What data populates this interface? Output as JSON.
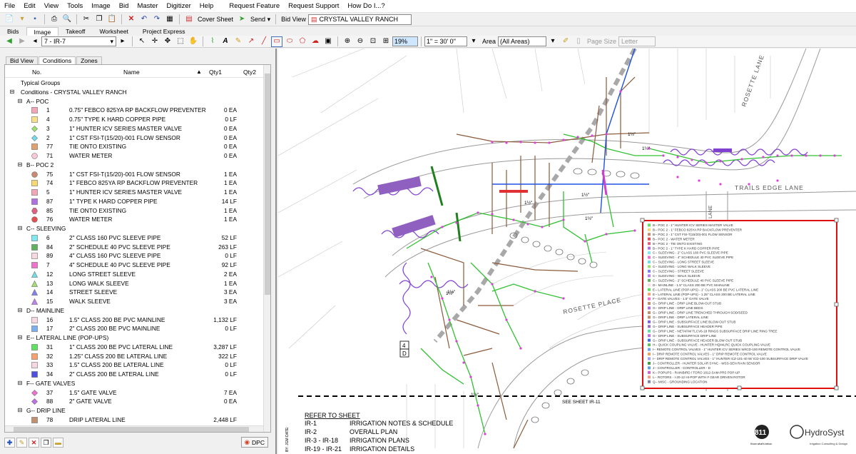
{
  "menu": [
    "File",
    "Edit",
    "View",
    "Tools",
    "Image",
    "Bid",
    "Master",
    "Digitizer",
    "Help",
    "Request Feature",
    "Request Support",
    "How Do I...?"
  ],
  "toolbar": {
    "cover_sheet": "Cover Sheet",
    "send": "Send",
    "bid_view_label": "Bid View",
    "bid_name": "CRYSTAL VALLEY RANCH"
  },
  "tabs": [
    "Bids",
    "Image",
    "Takeoff",
    "Worksheet",
    "Project Express"
  ],
  "active_tab": "Image",
  "image_toolbar": {
    "page": "7 - IR-7",
    "zoom": "19%",
    "scale": "1\" = 30' 0\"",
    "area_label": "Area",
    "area_value": "(All Areas)",
    "page_size_label": "Page Size",
    "page_size_value": "Letter"
  },
  "panel": {
    "tabs": [
      "Bid View",
      "Conditions",
      "Zones"
    ],
    "active": "Conditions",
    "columns": {
      "no": "No.",
      "name": "Name",
      "qty1": "Qty1",
      "qty2": "Qty2"
    },
    "typical_groups": "Typical Groups",
    "root": "Conditions - CRYSTAL VALLEY RANCH",
    "groups": [
      {
        "name": "A-- POC",
        "items": [
          {
            "no": "1",
            "name": "0.75\" FEBCO 825YA RP BACKFLOW PREVENTER",
            "qty1": "0 EA",
            "color": "#f4a6b6",
            "shape": "square"
          },
          {
            "no": "4",
            "name": "0.75\" TYPE K HARD COPPER PIPE",
            "qty1": "0 LF",
            "color": "#f8e08a",
            "shape": "square"
          },
          {
            "no": "3",
            "name": "1\"  HUNTER ICV SERIES MASTER VALVE",
            "qty1": "0 EA",
            "color": "#9be36a",
            "shape": "diamond"
          },
          {
            "no": "2",
            "name": "1\" CST FSI-T(15/20)-001 FLOW SENSOR",
            "qty1": "0 EA",
            "color": "#6fdcf0",
            "shape": "diamond"
          },
          {
            "no": "77",
            "name": "TIE ONTO EXISTING",
            "qty1": "0 EA",
            "color": "#e0a070",
            "shape": "square"
          },
          {
            "no": "71",
            "name": "WATER METER",
            "qty1": "0 EA",
            "color": "#f8c8d8",
            "shape": "circle"
          }
        ]
      },
      {
        "name": "B-- POC 2",
        "items": [
          {
            "no": "75",
            "name": "1\" CST FSI-T(15/20)-001 FLOW SENSOR",
            "qty1": "1 EA",
            "color": "#c88a70",
            "shape": "circle"
          },
          {
            "no": "74",
            "name": "1\" FEBCO 825YA RP BACKFLOW PREVENTER",
            "qty1": "1 EA",
            "color": "#f8d870",
            "shape": "square"
          },
          {
            "no": "5",
            "name": "1\" HUNTER ICV SERIES MASTER VALVE",
            "qty1": "1 EA",
            "color": "#f4a6b6",
            "shape": "square"
          },
          {
            "no": "87",
            "name": "1\" TYPE K HARD COPPER PIPE",
            "qty1": "14 LF",
            "color": "#b070e0",
            "shape": "square"
          },
          {
            "no": "85",
            "name": "TIE ONTO EXISTING",
            "qty1": "1 EA",
            "color": "#e06080",
            "shape": "hex"
          },
          {
            "no": "76",
            "name": "WATER METER",
            "qty1": "1 EA",
            "color": "#e05050",
            "shape": "circle"
          }
        ]
      },
      {
        "name": "C-- SLEEVING",
        "items": [
          {
            "no": "6",
            "name": "2\" CLASS 160 PVC SLEEVE PIPE",
            "qty1": "52 LF",
            "color": "#7fe8f0",
            "shape": "square"
          },
          {
            "no": "84",
            "name": "2\" SCHEDULE 40 PVC SLEEVE PIPE",
            "qty1": "263 LF",
            "color": "#60b060",
            "shape": "square"
          },
          {
            "no": "89",
            "name": "4\" CLASS 160 PVC SLEEVE PIPE",
            "qty1": "0 LF",
            "color": "#f8d8e0",
            "shape": "square"
          },
          {
            "no": "7",
            "name": "4\" SCHEDULE 40 PVC SLEEVE PIPE",
            "qty1": "92 LF",
            "color": "#f070d0",
            "shape": "square"
          },
          {
            "no": "12",
            "name": "LONG STREET SLEEVE",
            "qty1": "2 EA",
            "color": "#70e0e8",
            "shape": "triangle"
          },
          {
            "no": "13",
            "name": "LONG WALK SLEEVE",
            "qty1": "1 EA",
            "color": "#a0e070",
            "shape": "triangle"
          },
          {
            "no": "14",
            "name": "STREET SLEEVE",
            "qty1": "3 EA",
            "color": "#8080f0",
            "shape": "triangle"
          },
          {
            "no": "15",
            "name": "WALK SLEEVE",
            "qty1": "3 EA",
            "color": "#c080f0",
            "shape": "triangle"
          }
        ]
      },
      {
        "name": "D-- MAINLINE",
        "items": [
          {
            "no": "16",
            "name": "1.5\" CLASS 200 BE PVC MAINLINE",
            "qty1": "1,132 LF",
            "color": "#f8d8e0",
            "shape": "square"
          },
          {
            "no": "17",
            "name": "2\" CLASS 200 BE PVC MAINLINE",
            "qty1": "0 LF",
            "color": "#7ab0f0",
            "shape": "square"
          }
        ]
      },
      {
        "name": "E-- LATERAL LINE (POP-UPS)",
        "items": [
          {
            "no": "31",
            "name": "1\" CLASS 200 BE PVC LATERAL LINE",
            "qty1": "3,287 LF",
            "color": "#60e060",
            "shape": "square"
          },
          {
            "no": "32",
            "name": "1.25\" CLASS 200 BE LATERAL LINE",
            "qty1": "322 LF",
            "color": "#f8a070",
            "shape": "square"
          },
          {
            "no": "33",
            "name": "1.5\" CLASS 200 BE LATERAL LINE",
            "qty1": "0 LF",
            "color": "#f8d8e0",
            "shape": "square"
          },
          {
            "no": "34",
            "name": "2\" CLASS 200 BE LATERAL LINE",
            "qty1": "0 LF",
            "color": "#5050e0",
            "shape": "square"
          }
        ]
      },
      {
        "name": "F-- GATE VALVES",
        "items": [
          {
            "no": "37",
            "name": "1.5\" GATE VALVE",
            "qty1": "7 EA",
            "color": "#f070d0",
            "shape": "diamond"
          },
          {
            "no": "88",
            "name": "2\" GATE VALVE",
            "qty1": "0 EA",
            "color": "#c070e0",
            "shape": "diamond"
          }
        ]
      },
      {
        "name": "G-- DRIP LINE",
        "items": [
          {
            "no": "78",
            "name": "DRIP LATERAL LINE",
            "qty1": "2,448 LF",
            "color": "#c09070",
            "shape": "square"
          }
        ]
      }
    ],
    "buttons": {
      "dpc": "DPC"
    }
  },
  "drawing": {
    "streets": [
      "ROSETTE LANE",
      "TRAILS EDGE LANE",
      "ROSETTE PLACE",
      "LANE"
    ],
    "see_sheet": "SEE SHEET IR-11",
    "sheet_tag": [
      "4",
      "D"
    ],
    "pipe_labels": [
      "1½\"",
      "1½\"",
      "1½\"",
      "1½\"",
      "1½\"",
      "1½\"",
      "1½\"",
      "1½\""
    ],
    "refer_title": "REFER TO SHEET",
    "refer_rows": [
      {
        "sheet": "IR-1",
        "desc": "IRRIGATION NOTES & SCHEDULE"
      },
      {
        "sheet": "IR-2",
        "desc": "OVERALL PLAN"
      },
      {
        "sheet": "IR-3 - IR-18",
        "desc": "IRRIGATION PLANS"
      },
      {
        "sheet": "IR-19 - IR-21",
        "desc": "IRRIGATION DETAILS"
      }
    ],
    "logo_811": "811",
    "logo_811_sub": "Know what's below.",
    "logo_hydro": "HydroSyst",
    "logo_hydro_sub": "Irrigation Consulting & Design",
    "side_text": "BY: JGM  DATE:",
    "legend": [
      "B-- POC 2 - 1\" HUNTER ICV SERIES MASTER VALVE",
      "B-- POC 2 - 1\" FEBCO 825YA RP BACKFLOW PREVENTER",
      "B-- POC 2 - 1\" CST FSI-T(15/20)-001 FLOW SENSOR",
      "B-- POC 2 - WATER METER",
      "B-- POC 2 - TIE ONTO EXISTING",
      "B-- POC 2 - 1\" TYPE K HARD COPPER PIPE",
      "C-- SLEEVING - 2\" CLASS 160 PVC SLEEVE PIPE",
      "C-- SLEEVING - 4\" SCHEDULE 40 PVC SLEEVE PIPE",
      "C-- SLEEVING - LONG STREET SLEEVE",
      "C-- SLEEVING - LONG WALK SLEEVE",
      "C-- SLEEVING - STREET SLEEVE",
      "C-- SLEEVING - WALK SLEEVE",
      "C-- SLEEVING - 2\" SCHEDULE 40 PVC SLEEVE PIPE",
      "D-- MAINLINE - 1.5\" CLASS 200 BE PVC MAINLINE",
      "E-- LATERAL LINE (POP-UPS) - 1\" CLASS 200 BE PVC LATERAL LINE",
      "E-- LATERAL LINE (POP-UPS) - 1.25\" CLASS 200 BE LATERAL LINE",
      "F-- GATE VALVES - 1.5\" GATE VALVE",
      "G-- DRIP LINE - DRIP LINE BLOW-OUT STUB",
      "G-- DRIP LINE - DRIP LINE BEDS",
      "G-- DRIP LINE - DRIP LINE TRENCHED THROUGH SOD/SEED",
      "G-- DRIP LINE - DRIP LATERAL LINE",
      "G-- DRIP LINE - SUBSURFACE LINE BLOW-OUT STUB",
      "G-- DRIP LINE - SUBSURFACE HEADER PIPE",
      "G-- DRIP LINE - NETAFIM TLCV6-18 RINGS SUBSURFACE DRIP LINE RING TREE",
      "G-- DRIP LINE - SUBSURFACE DRIP LINE",
      "G-- DRIP LINE - SUBSURFACE HEADER BLOW OUT STUB",
      "H-- QUICK COUPLING VALVE - HUNTER HQ44LRC QUICK COUPLING VALVE",
      "I-- REMOTE CONTROL VALVES - 1\" HUNTER ICV SERIES W/ICD-100 REMOTE CONTROL VALVE",
      "I-- DRIP REMOTE CONTROL VALVES - 1\" DRIP REMOTE CONTROL VALVE",
      "I-- DRIP REMOTE CONTROL VALVES - 1\" HUNTER ICZ-101-40 W/ ICD-100 SUBSURFACE DRIP VALVE",
      "J-- CONTROLLER - HUNTER SOLAR SYNC - WSS-SEN RAIN SENSOR",
      "J-- CONTROLLER - CONTROLLER - D",
      "K-- POPUPS - RAINBIRD / TORO 1812-SAM-PRS POP-UP",
      "L-- ROTORS - I-20-12 HI-POP WITH # GEAR DRIVEN ROTOR",
      "Q-- MISC - GROUNDING LOCATION"
    ],
    "legend_colors": [
      "#60e060",
      "#f8d870",
      "#c88a70",
      "#e05050",
      "#e06080",
      "#b070e0",
      "#7fe8f0",
      "#f070d0",
      "#70e0e8",
      "#a0e070",
      "#8080f0",
      "#c080f0",
      "#60b060",
      "#f8d8e0",
      "#60e060",
      "#f8a070",
      "#f070d0",
      "#c09070",
      "#b070e0",
      "#c09070",
      "#c09070",
      "#8060e0",
      "#a070c0",
      "#60e0a0",
      "#c070e0",
      "#4070e0",
      "#60c060",
      "#70a0f0",
      "#f0a060",
      "#a0a0f0",
      "#40a040",
      "#60a0e0",
      "#d060d0",
      "#f0a080",
      "#8080a0"
    ]
  }
}
